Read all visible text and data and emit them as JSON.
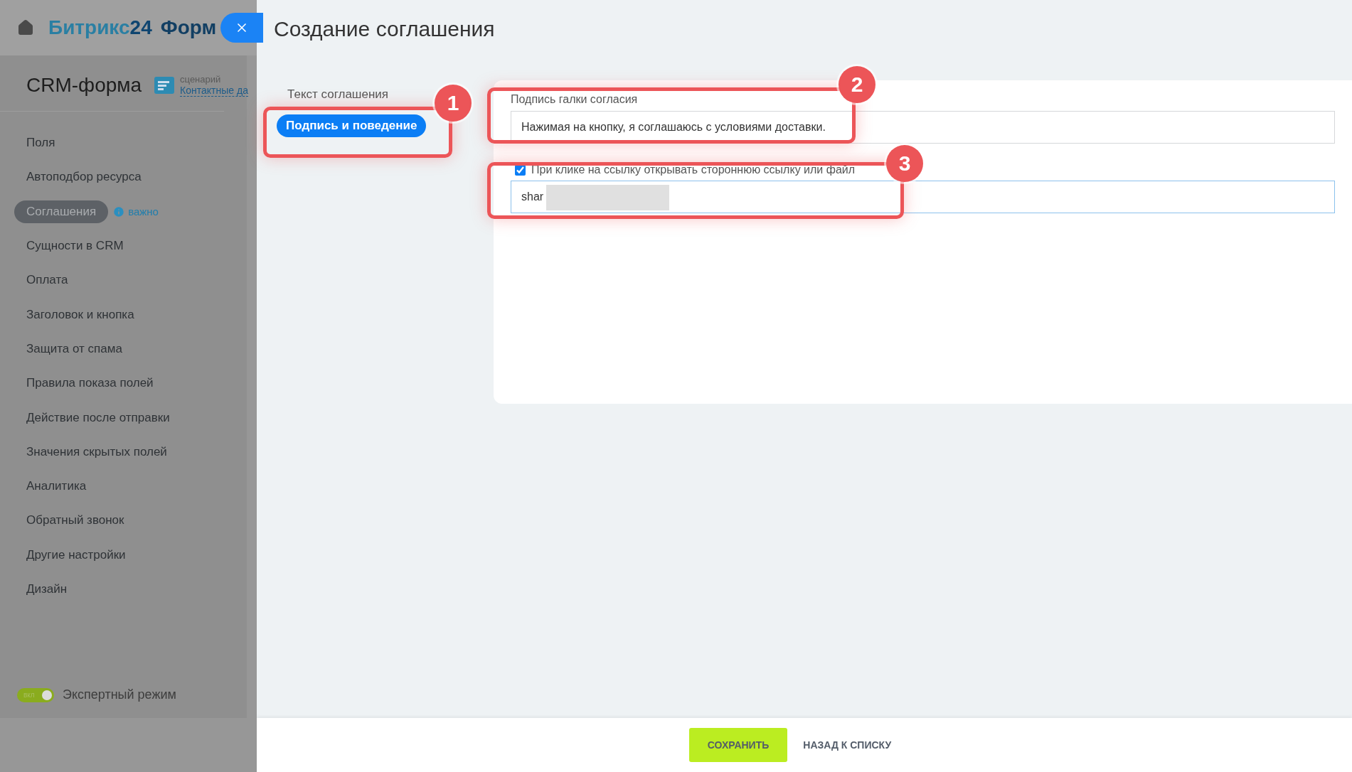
{
  "header": {
    "brand": "Битрикс",
    "brand_number": "24",
    "brand_suffix": "Форм"
  },
  "form": {
    "title": "CRM-форма",
    "scenario_label": "сценарий",
    "scenario_link": "Контактные да"
  },
  "menu": [
    {
      "label": "Поля",
      "selected": false
    },
    {
      "label": "Автоподбор ресурса",
      "selected": false
    },
    {
      "label": "Соглашения",
      "selected": true,
      "badge": "важно"
    },
    {
      "label": "Сущности в CRM",
      "selected": false
    },
    {
      "label": "Оплата",
      "selected": false
    },
    {
      "label": "Заголовок и кнопка",
      "selected": false
    },
    {
      "label": "Защита от спама",
      "selected": false
    },
    {
      "label": "Правила показа полей",
      "selected": false
    },
    {
      "label": "Действие после отправки",
      "selected": false
    },
    {
      "label": "Значения скрытых полей",
      "selected": false
    },
    {
      "label": "Аналитика",
      "selected": false
    },
    {
      "label": "Обратный звонок",
      "selected": false
    },
    {
      "label": "Другие настройки",
      "selected": false
    },
    {
      "label": "Дизайн",
      "selected": false
    }
  ],
  "expert_mode": {
    "label": "Экспертный режим",
    "toggle_text": "вкл",
    "on": true
  },
  "panel": {
    "title": "Создание соглашения",
    "nav": [
      {
        "label": "Текст соглашения",
        "selected": false
      },
      {
        "label": "Подпись и поведение",
        "selected": true
      }
    ],
    "caption_label": "Подпись галки согласия",
    "caption_value": "Нажимая на кнопку, я соглашаюсь с условиями доставки.",
    "link_checkbox": {
      "label": "При клике на ссылку открывать стороннюю ссылку или файл",
      "checked": true
    },
    "link_value": "shar"
  },
  "callouts": [
    "1",
    "2",
    "3"
  ],
  "footer": {
    "save": "СОХРАНИТЬ",
    "back": "НАЗАД К СПИСКУ"
  }
}
